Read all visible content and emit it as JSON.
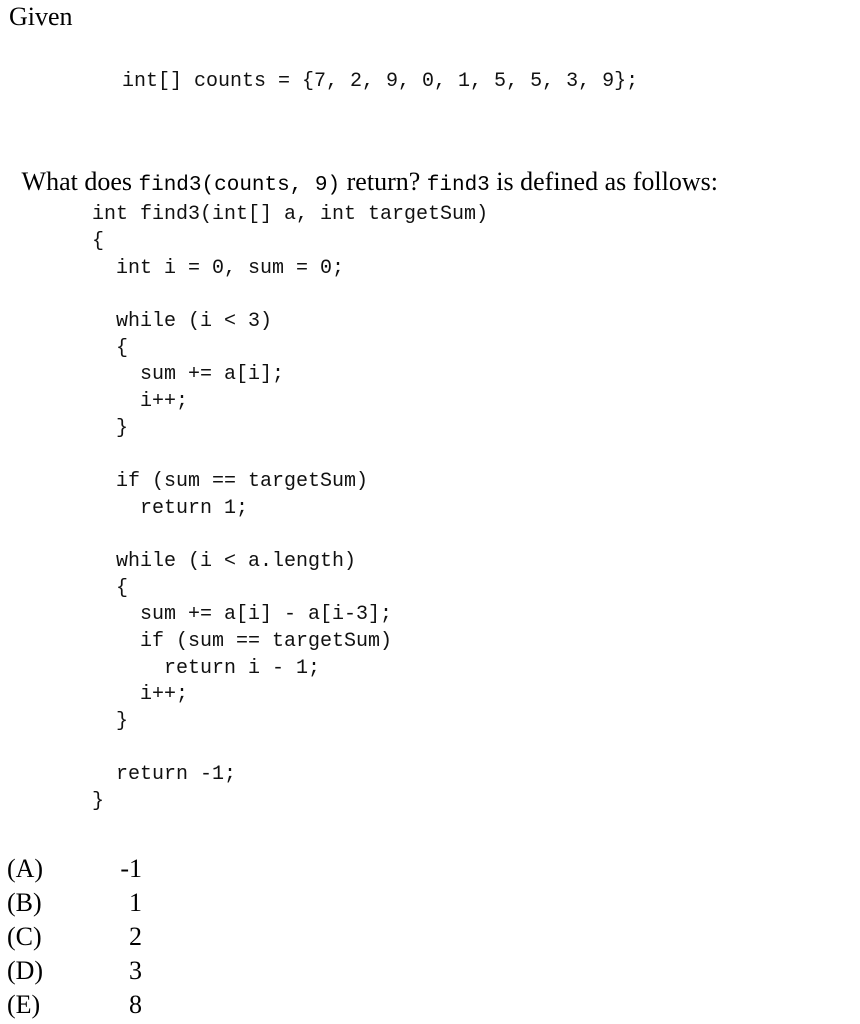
{
  "intro": "Given",
  "array_decl": "int[] counts = {7, 2, 9, 0, 1, 5, 5, 3, 9};",
  "question": {
    "text1": "What does ",
    "code1": "find3(counts, 9)",
    "text2": " return? ",
    "code2": "find3",
    "text3": " is defined as follows:"
  },
  "code_lines": [
    "int find3(int[] a, int targetSum)",
    "{",
    "  int i = 0, sum = 0;",
    "",
    "  while (i < 3)",
    "  {",
    "    sum += a[i];",
    "    i++;",
    "  }",
    "",
    "  if (sum == targetSum)",
    "    return 1;",
    "",
    "  while (i < a.length)",
    "  {",
    "    sum += a[i] - a[i-3];",
    "    if (sum == targetSum)",
    "      return i - 1;",
    "    i++;",
    "  }",
    "",
    "  return -1;",
    "}"
  ],
  "choices": [
    {
      "letter": "(A)",
      "value": "-1"
    },
    {
      "letter": "(B)",
      "value": "1"
    },
    {
      "letter": "(C)",
      "value": "2"
    },
    {
      "letter": "(D)",
      "value": "3"
    },
    {
      "letter": "(E)",
      "value": "8"
    }
  ]
}
